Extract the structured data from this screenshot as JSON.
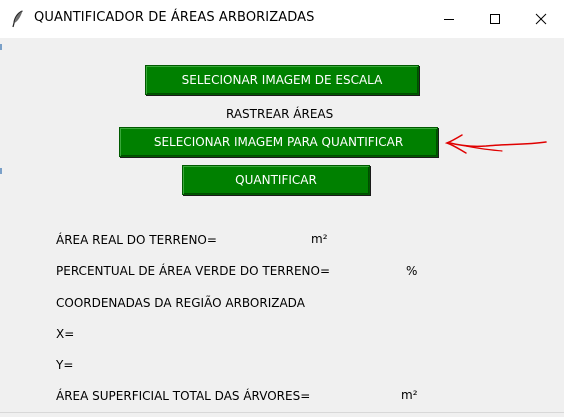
{
  "window": {
    "title": "QUANTIFICADOR DE ÁREAS ARBORIZADAS",
    "icon": "feather-icon",
    "controls": [
      "minimize-icon",
      "maximize-icon",
      "close-icon"
    ]
  },
  "buttons": {
    "select_scale": "SELECIONAR IMAGEM DE ESCALA",
    "select_quantify": "SELECIONAR IMAGEM PARA QUANTIFICAR",
    "quantify": "QUANTIFICAR"
  },
  "labels": {
    "track_areas": "RASTREAR ÁREAS"
  },
  "results": {
    "real_area_label": "ÁREA REAL DO TERRENO=",
    "real_area_unit": "m²",
    "green_percent_label": "PERCENTUAL DE ÁREA VERDE DO TERRENO=",
    "green_percent_unit": "%",
    "coords_label": "COORDENADAS DA REGIÃO ARBORIZADA",
    "x_label": "X=",
    "y_label": "Y=",
    "tree_area_label": "ÁREA SUPERFICIAL TOTAL DAS ÁRVORES=",
    "tree_area_unit": "m²"
  },
  "colors": {
    "button_bg": "#008000",
    "button_text": "#ffffff",
    "annotation_arrow": "#e00000",
    "background": "#f0f0f0"
  }
}
